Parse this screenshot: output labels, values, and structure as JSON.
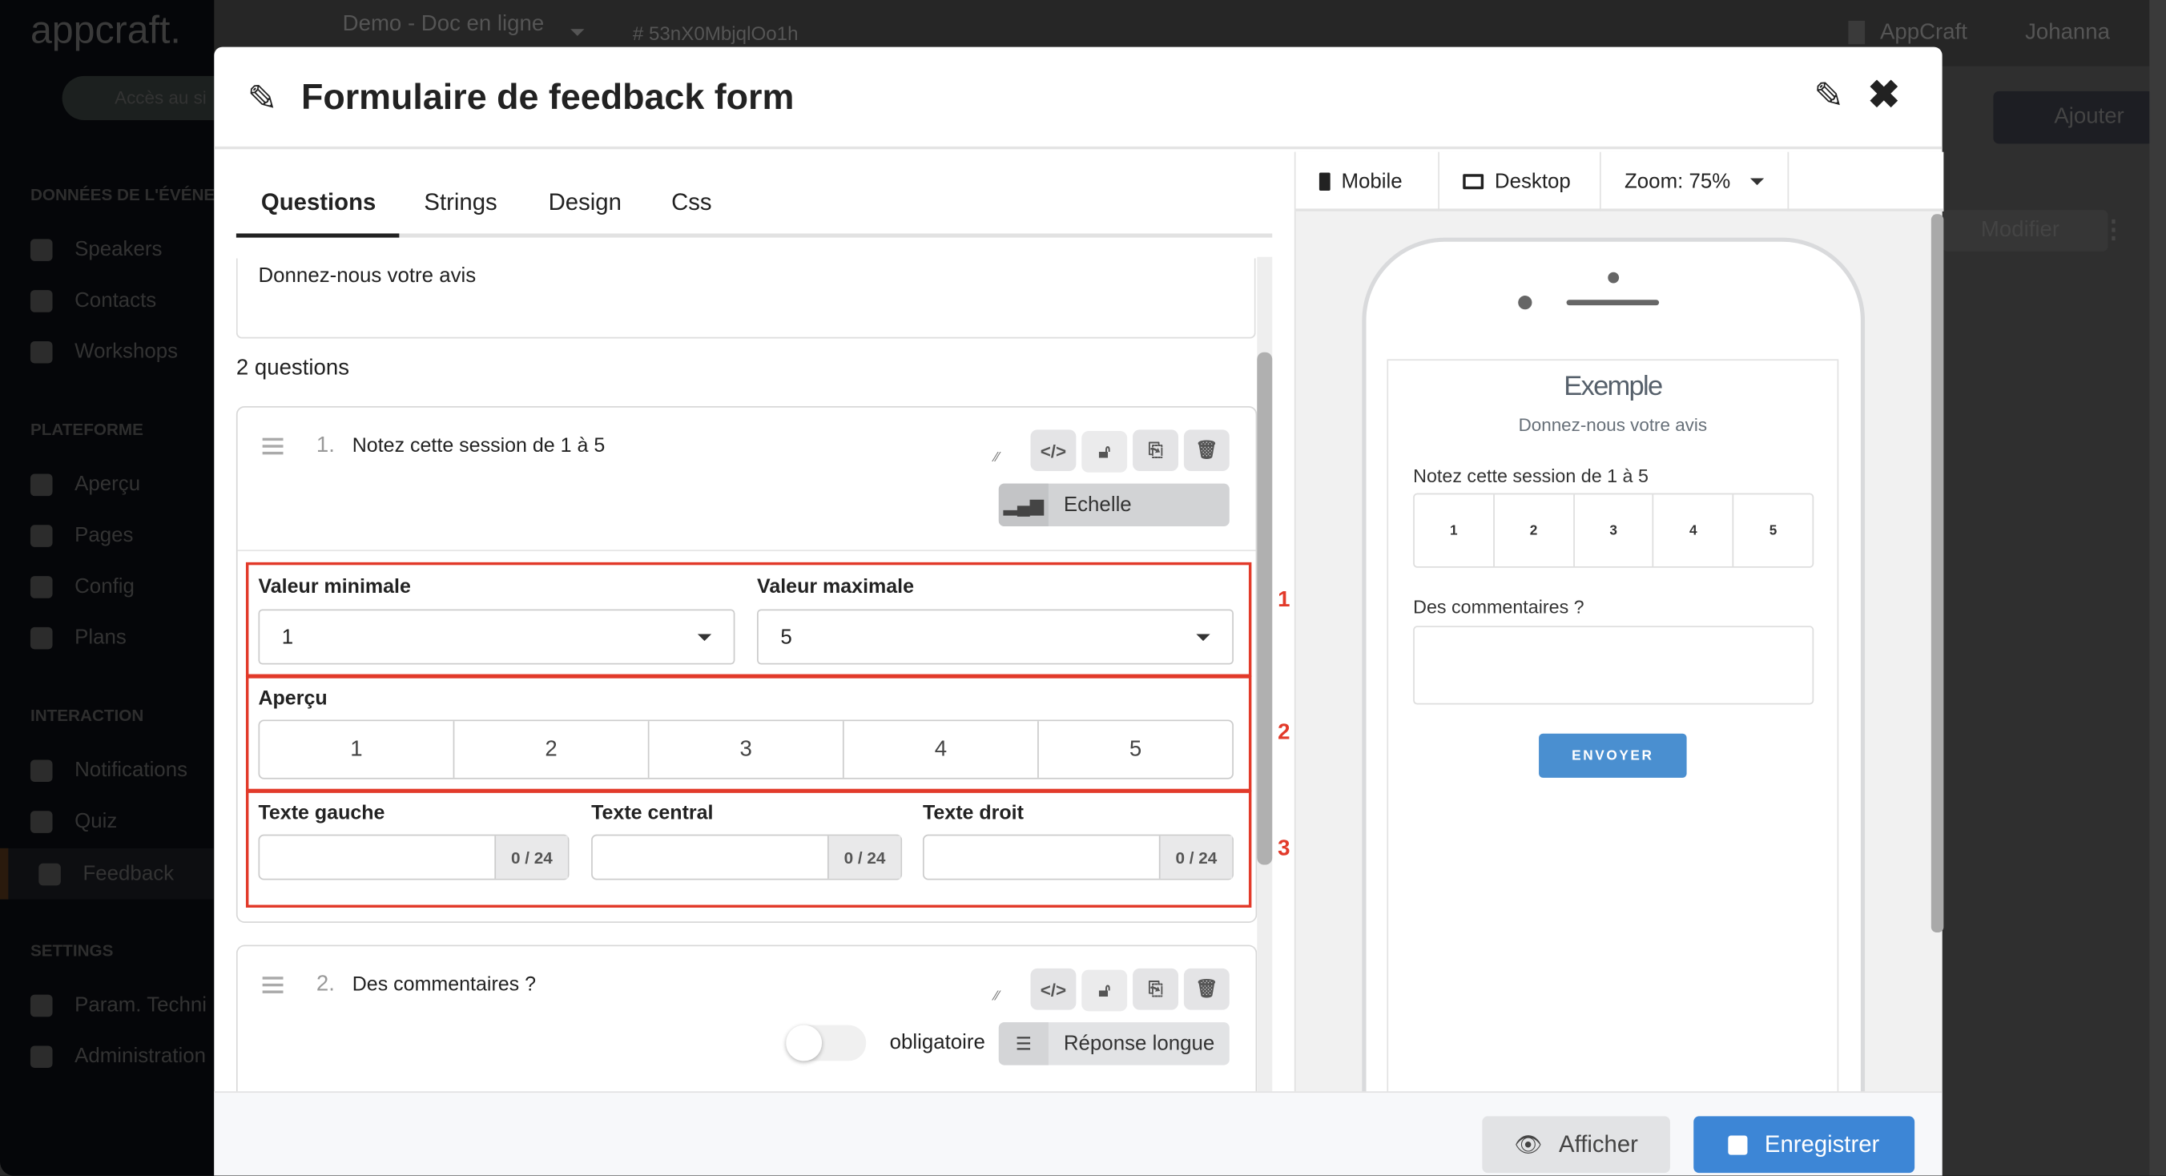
{
  "background_app": {
    "logo": "appcraft.",
    "project_name": "Demo - Doc en ligne",
    "project_owner": "Johanna",
    "project_id": "# 53nX0MbjqlOo1h",
    "org": "AppCraft",
    "user": "Johanna",
    "site_access_button": "Accès au si",
    "add_button": "Ajouter",
    "modify_button": "Modifier",
    "sidebar": {
      "sections": [
        {
          "title": "DONNÉES DE L'ÉVÉNE",
          "items": [
            "Speakers",
            "Contacts",
            "Workshops"
          ]
        },
        {
          "title": "PLATEFORME",
          "items": [
            "Aperçu",
            "Pages",
            "Config",
            "Plans"
          ]
        },
        {
          "title": "INTERACTION",
          "items": [
            "Notifications",
            "Quiz",
            "Feedback"
          ]
        },
        {
          "title": "SETTINGS",
          "items": [
            "Param. Techni",
            "Administration"
          ]
        }
      ],
      "active_item": "Feedback"
    }
  },
  "modal": {
    "title": "Formulaire de feedback form",
    "tabs": [
      "Questions",
      "Strings",
      "Design",
      "Css"
    ],
    "active_tab": "Questions",
    "description": "Donnez-nous votre avis",
    "question_count": "2 questions",
    "questions": [
      {
        "number": "1.",
        "text": "Notez cette session de 1 à 5",
        "type": "Echelle",
        "min_label": "Valeur minimale",
        "min_value": "1",
        "max_label": "Valeur maximale",
        "max_value": "5",
        "preview_label": "Aperçu",
        "preview_values": [
          "1",
          "2",
          "3",
          "4",
          "5"
        ],
        "left_text_label": "Texte gauche",
        "center_text_label": "Texte central",
        "right_text_label": "Texte droit",
        "counter": "0 / 24"
      },
      {
        "number": "2.",
        "text": "Des commentaires ?",
        "type": "Réponse longue",
        "required_label": "obligatoire",
        "required": false
      }
    ],
    "annotations": [
      "1",
      "2",
      "3"
    ],
    "preview": {
      "tabs": [
        "Mobile",
        "Desktop"
      ],
      "active_tab": "Mobile",
      "zoom": "Zoom: 75%",
      "form_title": "Exemple",
      "form_subtitle": "Donnez-nous votre avis",
      "q1": "Notez cette session de 1 à 5",
      "q1_values": [
        "1",
        "2",
        "3",
        "4",
        "5"
      ],
      "q2": "Des commentaires ?",
      "submit": "ENVOYER"
    },
    "footer": {
      "show_button": "Afficher",
      "save_button": "Enregistrer"
    }
  },
  "colors": {
    "annotation_red": "#e23a2a",
    "primary_blue": "#3d86d6",
    "preview_button": "#4a8fd0"
  }
}
